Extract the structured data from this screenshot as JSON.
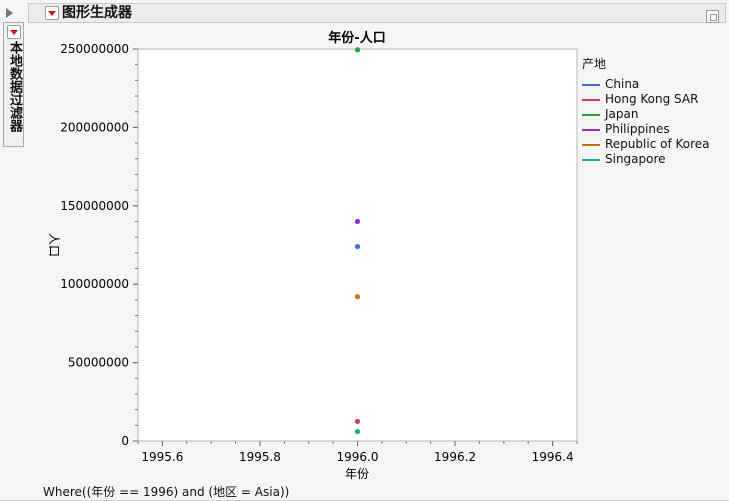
{
  "header": {
    "title": "图形生成器"
  },
  "local_filter": {
    "label": "本地数据过滤器"
  },
  "legend": {
    "title": "产地",
    "items": [
      {
        "label": "China",
        "color": "#3a6fd8"
      },
      {
        "label": "Hong Kong SAR",
        "color": "#c8415b"
      },
      {
        "label": "Japan",
        "color": "#2ea043"
      },
      {
        "label": "Philippines",
        "color": "#9b2fc4"
      },
      {
        "label": "Republic of Korea",
        "color": "#c9721c"
      },
      {
        "label": "Singapore",
        "color": "#1aa88e"
      }
    ]
  },
  "footer": {
    "where": "Where((年份 == 1996) and (地区 = Asia))"
  },
  "chart_data": {
    "type": "scatter",
    "title": "年份-人口",
    "xlabel": "年份",
    "ylabel": "人口",
    "xlim": [
      1995.55,
      1996.45
    ],
    "ylim": [
      0,
      250000000
    ],
    "xticks": [
      1995.6,
      1995.8,
      1996.0,
      1996.2,
      1996.4
    ],
    "xtick_labels": [
      "1995.6",
      "1995.8",
      "1996.0",
      "1996.2",
      "1996.4"
    ],
    "yticks": [
      0,
      50000000,
      100000000,
      150000000,
      200000000,
      250000000
    ],
    "ytick_labels": [
      "0",
      "50000000",
      "100000000",
      "150000000",
      "200000000",
      "250000000"
    ],
    "grid": false,
    "legend_position": "right",
    "series": [
      {
        "name": "China",
        "x": [
          1996.0
        ],
        "y": [
          124000000
        ]
      },
      {
        "name": "Hong Kong SAR",
        "x": [
          1996.0
        ],
        "y": [
          12500000
        ]
      },
      {
        "name": "Japan",
        "x": [
          1996.0
        ],
        "y": [
          249500000
        ]
      },
      {
        "name": "Philippines",
        "x": [
          1996.0
        ],
        "y": [
          140000000
        ]
      },
      {
        "name": "Republic of Korea",
        "x": [
          1996.0
        ],
        "y": [
          92000000
        ]
      },
      {
        "name": "Singapore",
        "x": [
          1996.0
        ],
        "y": [
          6000000
        ]
      }
    ]
  }
}
